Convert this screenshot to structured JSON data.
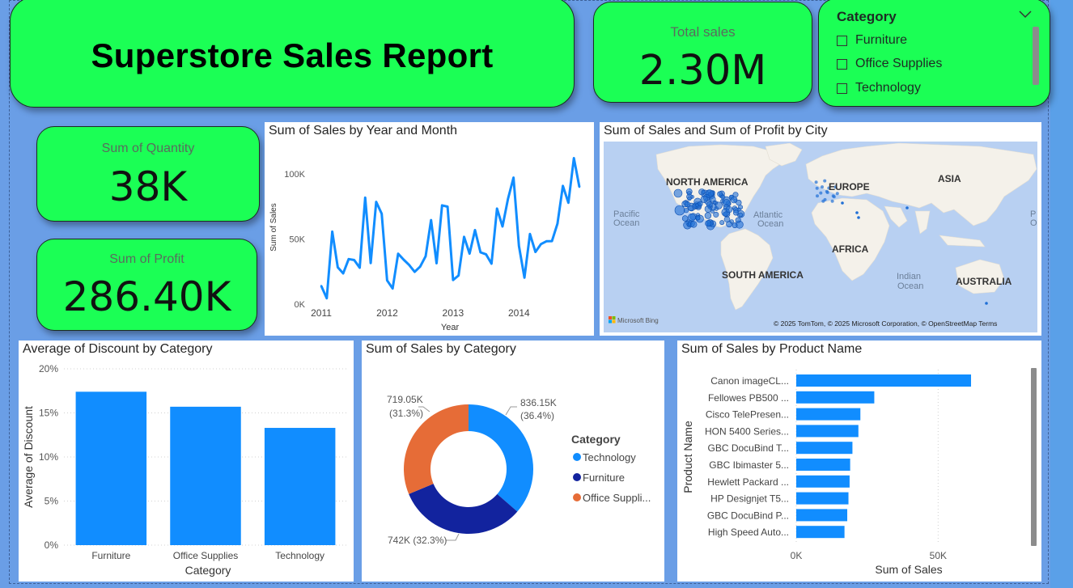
{
  "header": {
    "title": "Superstore Sales Report"
  },
  "kpis": {
    "total_sales": {
      "label": "Total sales",
      "value": "2.30M"
    },
    "quantity": {
      "label": "Sum of Quantity",
      "value": "38K"
    },
    "profit": {
      "label": "Sum of Profit",
      "value": "286.40K"
    }
  },
  "slicer": {
    "title": "Category",
    "options": [
      "Furniture",
      "Office Supplies",
      "Technology"
    ]
  },
  "map": {
    "title": "Sum of Sales and Sum of Profit by City",
    "labels": {
      "north_america": "NORTH AMERICA",
      "europe": "EUROPE",
      "asia": "ASIA",
      "africa": "AFRICA",
      "south_america": "SOUTH AMERICA",
      "australia": "AUSTRALIA",
      "pacific_1": "Pacific",
      "pacific_2": "Ocean",
      "atlantic_1": "Atlantic",
      "atlantic_2": "Ocean",
      "indian_1": "Indian",
      "indian_2": "Ocean",
      "edge_1": "P",
      "edge_2": "O"
    },
    "attribution": "© 2025 TomTom, © 2025 Microsoft Corporation, © OpenStreetMap  Terms",
    "bing": "Microsoft Bing"
  },
  "colors": {
    "bar_blue": "#118dff",
    "furniture_navy": "#12239e",
    "office_orange": "#e66c37",
    "kpi_green": "#1bff55",
    "page_blue": "#6a9ee6"
  },
  "chart_data": [
    {
      "id": "line",
      "type": "line",
      "title": "Sum of Sales by Year and Month",
      "xlabel": "Year",
      "ylabel": "Sum of Sales",
      "x_ticks": [
        "2011",
        "2012",
        "2013",
        "2014"
      ],
      "y_ticks": [
        "0K",
        "50K",
        "100K"
      ],
      "ylim": [
        0,
        115000
      ],
      "x": [
        "2011-01",
        "2011-02",
        "2011-03",
        "2011-04",
        "2011-05",
        "2011-06",
        "2011-07",
        "2011-08",
        "2011-09",
        "2011-10",
        "2011-11",
        "2011-12",
        "2012-01",
        "2012-02",
        "2012-03",
        "2012-04",
        "2012-05",
        "2012-06",
        "2012-07",
        "2012-08",
        "2012-09",
        "2012-10",
        "2012-11",
        "2012-12",
        "2013-01",
        "2013-02",
        "2013-03",
        "2013-04",
        "2013-05",
        "2013-06",
        "2013-07",
        "2013-08",
        "2013-09",
        "2013-10",
        "2013-11",
        "2013-12",
        "2014-01",
        "2014-02",
        "2014-03",
        "2014-04",
        "2014-05",
        "2014-06",
        "2014-07",
        "2014-08",
        "2014-09",
        "2014-10",
        "2014-11",
        "2014-12"
      ],
      "values": [
        14000,
        4500,
        55700,
        28300,
        23600,
        34600,
        33900,
        28000,
        81800,
        31500,
        78600,
        69500,
        18200,
        12000,
        38700,
        34200,
        30100,
        24800,
        28800,
        36800,
        64600,
        31400,
        75900,
        74900,
        18500,
        22000,
        51700,
        38800,
        56900,
        39800,
        38300,
        31100,
        73400,
        59700,
        81000,
        97200,
        44700,
        20300,
        53900,
        40100,
        46100,
        48300,
        48400,
        61800,
        90900,
        77900,
        112200,
        90000
      ]
    },
    {
      "id": "discount",
      "type": "bar",
      "title": "Average of Discount by Category",
      "xlabel": "Category",
      "ylabel": "Average of Discount",
      "categories": [
        "Furniture",
        "Office Supplies",
        "Technology"
      ],
      "values": [
        17.4,
        15.7,
        13.3
      ],
      "y_ticks": [
        "0%",
        "5%",
        "10%",
        "15%",
        "20%"
      ],
      "ylim": [
        0,
        20
      ]
    },
    {
      "id": "donut",
      "type": "pie",
      "title": "Sum of Sales by Category",
      "legend_title": "Category",
      "slices": [
        {
          "name": "Technology",
          "legend": "Technology",
          "value": 836.15,
          "label_value": "836.15K",
          "label_pct": "(36.4%)",
          "color": "#118dff"
        },
        {
          "name": "Furniture",
          "legend": "Furniture",
          "value": 742,
          "label_value": "742K (32.3%)",
          "label_pct": "",
          "color": "#12239e"
        },
        {
          "name": "Office Supplies",
          "legend": "Office Suppli...",
          "value": 719.05,
          "label_value": "719.05K",
          "label_pct": "(31.3%)",
          "color": "#e66c37"
        }
      ]
    },
    {
      "id": "products",
      "type": "bar",
      "orientation": "horizontal",
      "title": "Sum of Sales by Product Name",
      "xlabel": "Sum of Sales",
      "ylabel": "Product Name",
      "categories": [
        "Canon imageCL...",
        "Fellowes PB500 ...",
        "Cisco TelePresen...",
        "HON 5400 Series...",
        "GBC DocuBind T...",
        "GBC Ibimaster 5...",
        "Hewlett Packard ...",
        "HP Designjet T5...",
        "GBC DocuBind P...",
        "High Speed Auto..."
      ],
      "values": [
        61600,
        27500,
        22600,
        21900,
        19800,
        19000,
        18800,
        18400,
        17970,
        17000
      ],
      "x_ticks": [
        "0K",
        "50K"
      ],
      "xlim": [
        0,
        75000
      ]
    }
  ]
}
